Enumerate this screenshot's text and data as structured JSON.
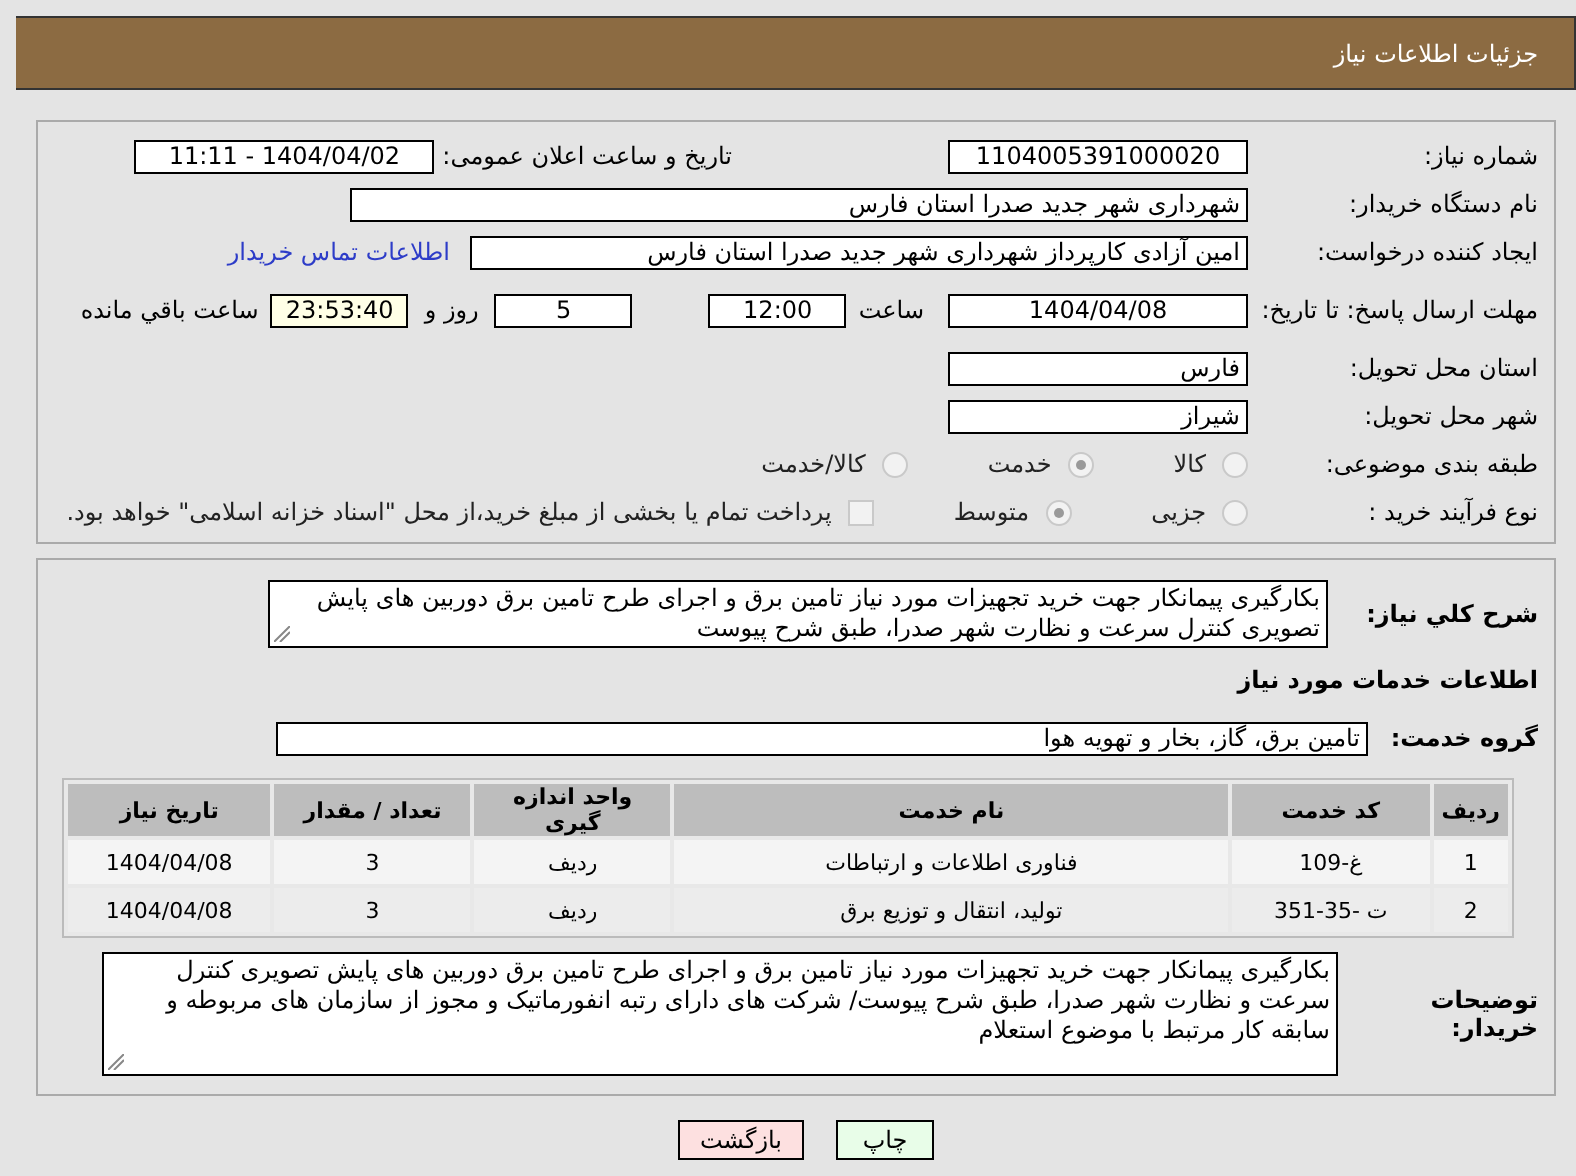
{
  "header": {
    "title": "جزئیات اطلاعات نیاز"
  },
  "need_number": {
    "label": "شماره نیاز:",
    "value": "1104005391000020"
  },
  "announce": {
    "label": "تاریخ و ساعت اعلان عمومی:",
    "value": "1404/04/02 - 11:11"
  },
  "buyer_org": {
    "label": "نام دستگاه خریدار:",
    "value": "شهرداری شهر جدید صدرا استان فارس"
  },
  "requester": {
    "label": "ایجاد کننده درخواست:",
    "value": "امین آزادی کارپرداز شهرداری شهر جدید صدرا استان فارس",
    "link": "اطلاعات تماس خریدار"
  },
  "deadline": {
    "label": "مهلت ارسال پاسخ: تا تاریخ:",
    "date": "1404/04/08",
    "time_label": "ساعت",
    "time": "12:00",
    "days": "5",
    "days_label": "روز و",
    "remaining": "23:53:40",
    "remaining_label": "ساعت باقي مانده"
  },
  "province": {
    "label": "استان محل تحویل:",
    "value": "فارس"
  },
  "city": {
    "label": "شهر محل تحویل:",
    "value": "شیراز"
  },
  "category": {
    "label": "طبقه بندی موضوعی:",
    "options": [
      {
        "label": "کالا",
        "selected": false
      },
      {
        "label": "خدمت",
        "selected": true
      },
      {
        "label": "کالا/خدمت",
        "selected": false
      }
    ]
  },
  "process": {
    "label": "نوع فرآیند خرید :",
    "options": [
      {
        "label": "جزیی",
        "selected": false
      },
      {
        "label": "متوسط",
        "selected": true
      }
    ],
    "payment": {
      "checked": false,
      "text": "پرداخت تمام یا بخشی از مبلغ خرید،از محل \"اسناد خزانه اسلامی\" خواهد بود."
    }
  },
  "description": {
    "label": "شرح کلي نیاز:",
    "value": "بکارگیری پیمانکار جهت خرید تجهیزات مورد نیاز تامین برق و اجرای طرح تامین برق دوربین های پایش تصویری کنترل سرعت و نظارت شهر صدرا، طبق شرح پیوست"
  },
  "services_heading": "اطلاعات خدمات مورد نیاز",
  "service_group": {
    "label": "گروه خدمت:",
    "value": "تامین برق، گاز، بخار و تهویه هوا"
  },
  "table": {
    "columns": [
      "ردیف",
      "کد خدمت",
      "نام خدمت",
      "واحد اندازه گیری",
      "تعداد / مقدار",
      "تاریخ نیاز"
    ],
    "rows": [
      [
        "1",
        "غ-109",
        "فناوری اطلاعات و ارتباطات",
        "ردیف",
        "3",
        "1404/04/08"
      ],
      [
        "2",
        "ت -35-351",
        "تولید، انتقال و توزیع برق",
        "ردیف",
        "3",
        "1404/04/08"
      ]
    ]
  },
  "buyer_notes": {
    "label": "توضیحات خریدار:",
    "value": "بکارگیری پیمانکار جهت خرید تجهیزات مورد نیاز تامین برق و اجرای طرح تامین برق دوربین های پایش تصویری کنترل سرعت و نظارت شهر صدرا، طبق شرح پیوست/ شرکت های دارای رتبه انفورماتیک و مجوز از سازمان های مربوطه و سابقه کار مرتبط با موضوع استعلام"
  },
  "buttons": [
    {
      "label": "چاپ",
      "kind": "print"
    },
    {
      "label": "بازگشت",
      "kind": "back"
    }
  ]
}
